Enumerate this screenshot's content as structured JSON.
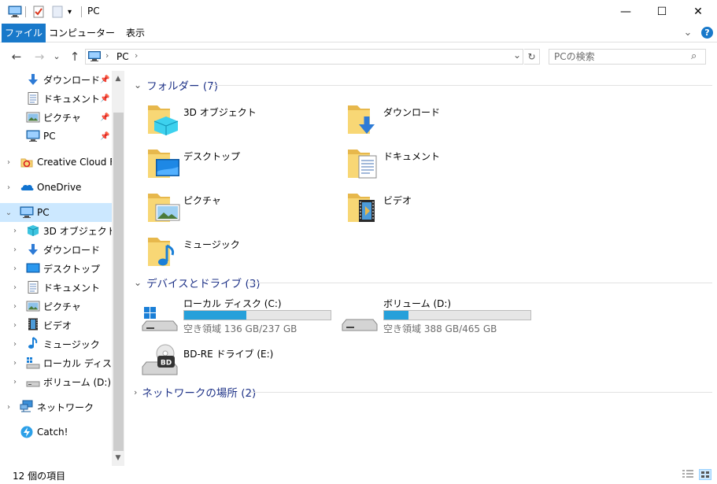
{
  "window": {
    "title": "PC",
    "minimize_glyph": "—",
    "maximize_glyph": "☐",
    "close_glyph": "✕"
  },
  "ribbon": {
    "tabs": [
      {
        "label": "ファイル",
        "active": true
      },
      {
        "label": "コンピューター",
        "active": false
      },
      {
        "label": "表示",
        "active": false
      }
    ],
    "expand_glyph": "⌄",
    "help_glyph": "?"
  },
  "nav": {
    "back_glyph": "←",
    "forward_glyph": "→",
    "recent_glyph": "⌄",
    "up_glyph": "↑",
    "breadcrumb": [
      "PC"
    ],
    "dropdown_glyph": "⌄",
    "refresh_glyph": "↻",
    "search_placeholder": "PCの検索",
    "search_glyph": "⌕"
  },
  "sidebar": {
    "quick_access": [
      {
        "label": "ダウンロード",
        "icon": "download-icon",
        "pinned": true
      },
      {
        "label": "ドキュメント",
        "icon": "document-icon",
        "pinned": true
      },
      {
        "label": "ピクチャ",
        "icon": "picture-icon",
        "pinned": true
      },
      {
        "label": "PC",
        "icon": "pc-icon",
        "pinned": true
      }
    ],
    "roots": [
      {
        "label": "Creative Cloud Files",
        "icon": "creative-cloud-icon"
      },
      {
        "label": "OneDrive",
        "icon": "onedrive-icon"
      },
      {
        "label": "PC",
        "icon": "pc-icon",
        "selected": true
      }
    ],
    "pc_children": [
      {
        "label": "3D オブジェクト",
        "icon": "3d-objects-icon"
      },
      {
        "label": "ダウンロード",
        "icon": "download-icon"
      },
      {
        "label": "デスクトップ",
        "icon": "desktop-icon"
      },
      {
        "label": "ドキュメント",
        "icon": "document-icon"
      },
      {
        "label": "ピクチャ",
        "icon": "picture-icon"
      },
      {
        "label": "ビデオ",
        "icon": "video-icon"
      },
      {
        "label": "ミュージック",
        "icon": "music-icon"
      },
      {
        "label": "ローカル ディスク (C:)",
        "icon": "local-disk-icon"
      },
      {
        "label": "ボリューム (D:)",
        "icon": "volume-icon"
      }
    ],
    "bottom": [
      {
        "label": "ネットワーク",
        "icon": "network-icon"
      },
      {
        "label": "Catch!",
        "icon": "catch-icon"
      }
    ]
  },
  "main": {
    "folders_header": "フォルダー (7)",
    "folders": [
      {
        "label": "3D オブジェクト",
        "icon": "3d-objects-folder-icon"
      },
      {
        "label": "ダウンロード",
        "icon": "download-folder-icon"
      },
      {
        "label": "デスクトップ",
        "icon": "desktop-folder-icon"
      },
      {
        "label": "ドキュメント",
        "icon": "document-folder-icon"
      },
      {
        "label": "ピクチャ",
        "icon": "picture-folder-icon"
      },
      {
        "label": "ビデオ",
        "icon": "video-folder-icon"
      },
      {
        "label": "ミュージック",
        "icon": "music-folder-icon"
      }
    ],
    "devices_header": "デバイスとドライブ (3)",
    "drives": [
      {
        "label": "ローカル ディスク (C:)",
        "free": "空き領域 136 GB/237 GB",
        "used_fraction": 0.426,
        "icon": "windows-drive-icon"
      },
      {
        "label": "ボリューム (D:)",
        "free": "空き領域 388 GB/465 GB",
        "used_fraction": 0.166,
        "icon": "hard-drive-icon"
      },
      {
        "label": "BD-RE ドライブ (E:)",
        "icon": "bd-drive-icon",
        "badge": "BD"
      }
    ],
    "network_header": "ネットワークの場所 (2)"
  },
  "status": {
    "item_count": "12 個の項目"
  },
  "colors": {
    "accent": "#1979ca",
    "header_text": "#1e3287",
    "drive_fill": "#26a0da",
    "selection": "#cce8ff",
    "folder": "#f8d775"
  }
}
